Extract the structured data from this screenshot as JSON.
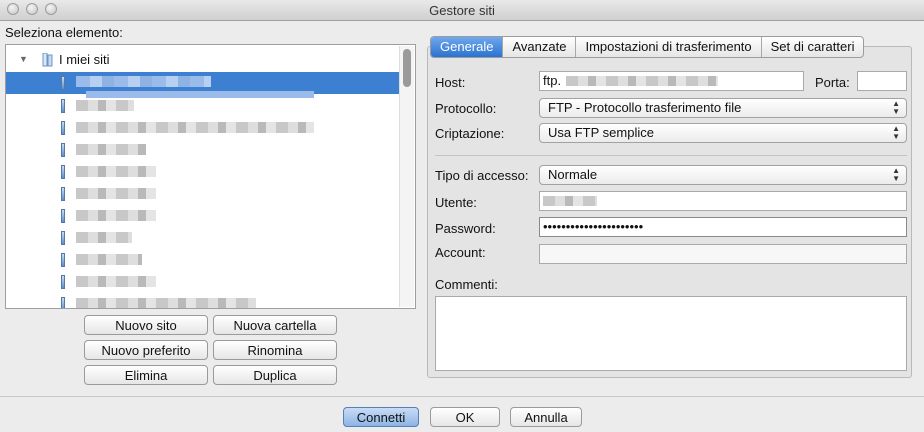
{
  "window": {
    "title": "Gestore siti"
  },
  "left": {
    "select_label": "Seleziona elemento:",
    "root_label": "I miei siti",
    "buttons": {
      "new_site": "Nuovo sito",
      "new_folder": "Nuova cartella",
      "new_bookmark": "Nuovo preferito",
      "rename": "Rinomina",
      "delete": "Elimina",
      "duplicate": "Duplica"
    }
  },
  "tabs": [
    "Generale",
    "Avanzate",
    "Impostazioni di trasferimento",
    "Set di caratteri"
  ],
  "form": {
    "host_label": "Host:",
    "host_value": "ftp.",
    "port_label": "Porta:",
    "port_value": "",
    "protocol_label": "Protocollo:",
    "protocol_value": "FTP - Protocollo trasferimento file",
    "encryption_label": "Criptazione:",
    "encryption_value": "Usa FTP semplice",
    "access_label": "Tipo di accesso:",
    "access_value": "Normale",
    "user_label": "Utente:",
    "password_label": "Password:",
    "password_value": "••••••••••••••••••••••",
    "account_label": "Account:",
    "account_value": "",
    "comments_label": "Commenti:",
    "comments_value": ""
  },
  "footer": {
    "connect": "Connetti",
    "ok": "OK",
    "cancel": "Annulla"
  }
}
